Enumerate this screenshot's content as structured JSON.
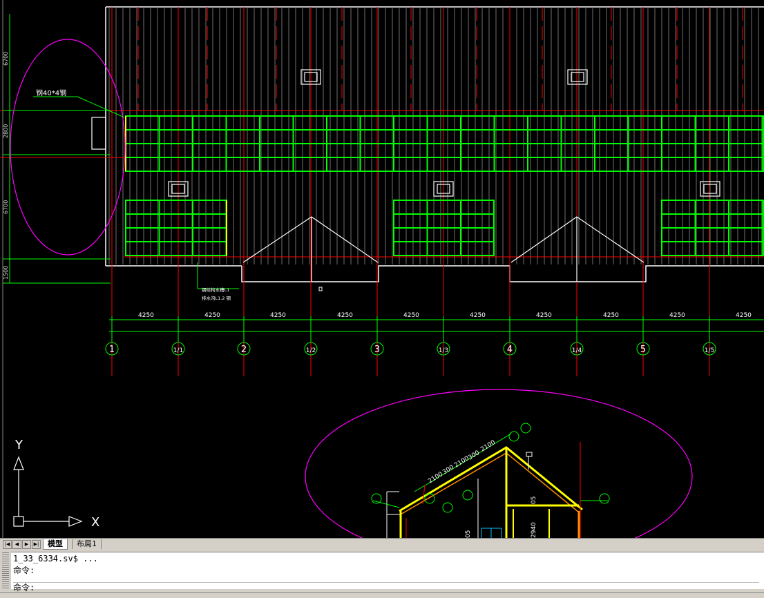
{
  "drawing": {
    "label_top_left": "钢40*4钢",
    "label_bottom_1": "钢结构水槽L1",
    "label_bottom_2": "排水沟L1.2 钢",
    "dimensions": {
      "spacing": "4250",
      "values": [
        "4250",
        "4250",
        "4250",
        "4250",
        "4250",
        "4250",
        "4250",
        "4250",
        "4250",
        "4250"
      ]
    },
    "left_dims": [
      "6700",
      "2800",
      "6700",
      "1500"
    ],
    "axis_labels": [
      "1",
      "1/1",
      "2",
      "1/2",
      "3",
      "1/3",
      "4",
      "1/4",
      "5",
      "1/5"
    ],
    "section_dims": [
      "2100",
      "300",
      "2100",
      "300",
      "2100",
      "05",
      "2940",
      "05"
    ],
    "ucs": {
      "x_label": "X",
      "y_label": "Y"
    }
  },
  "tabs": {
    "model": "模型",
    "layout1": "布局1"
  },
  "command": {
    "history": "1_33_6334.sv$ ...",
    "line1": "命令:",
    "line2": "命令:"
  },
  "colors": {
    "background": "#000000",
    "green": "#00ff00",
    "red": "#ff0000",
    "magenta": "#ff00ff",
    "yellow": "#ffff00",
    "white": "#ffffff"
  }
}
